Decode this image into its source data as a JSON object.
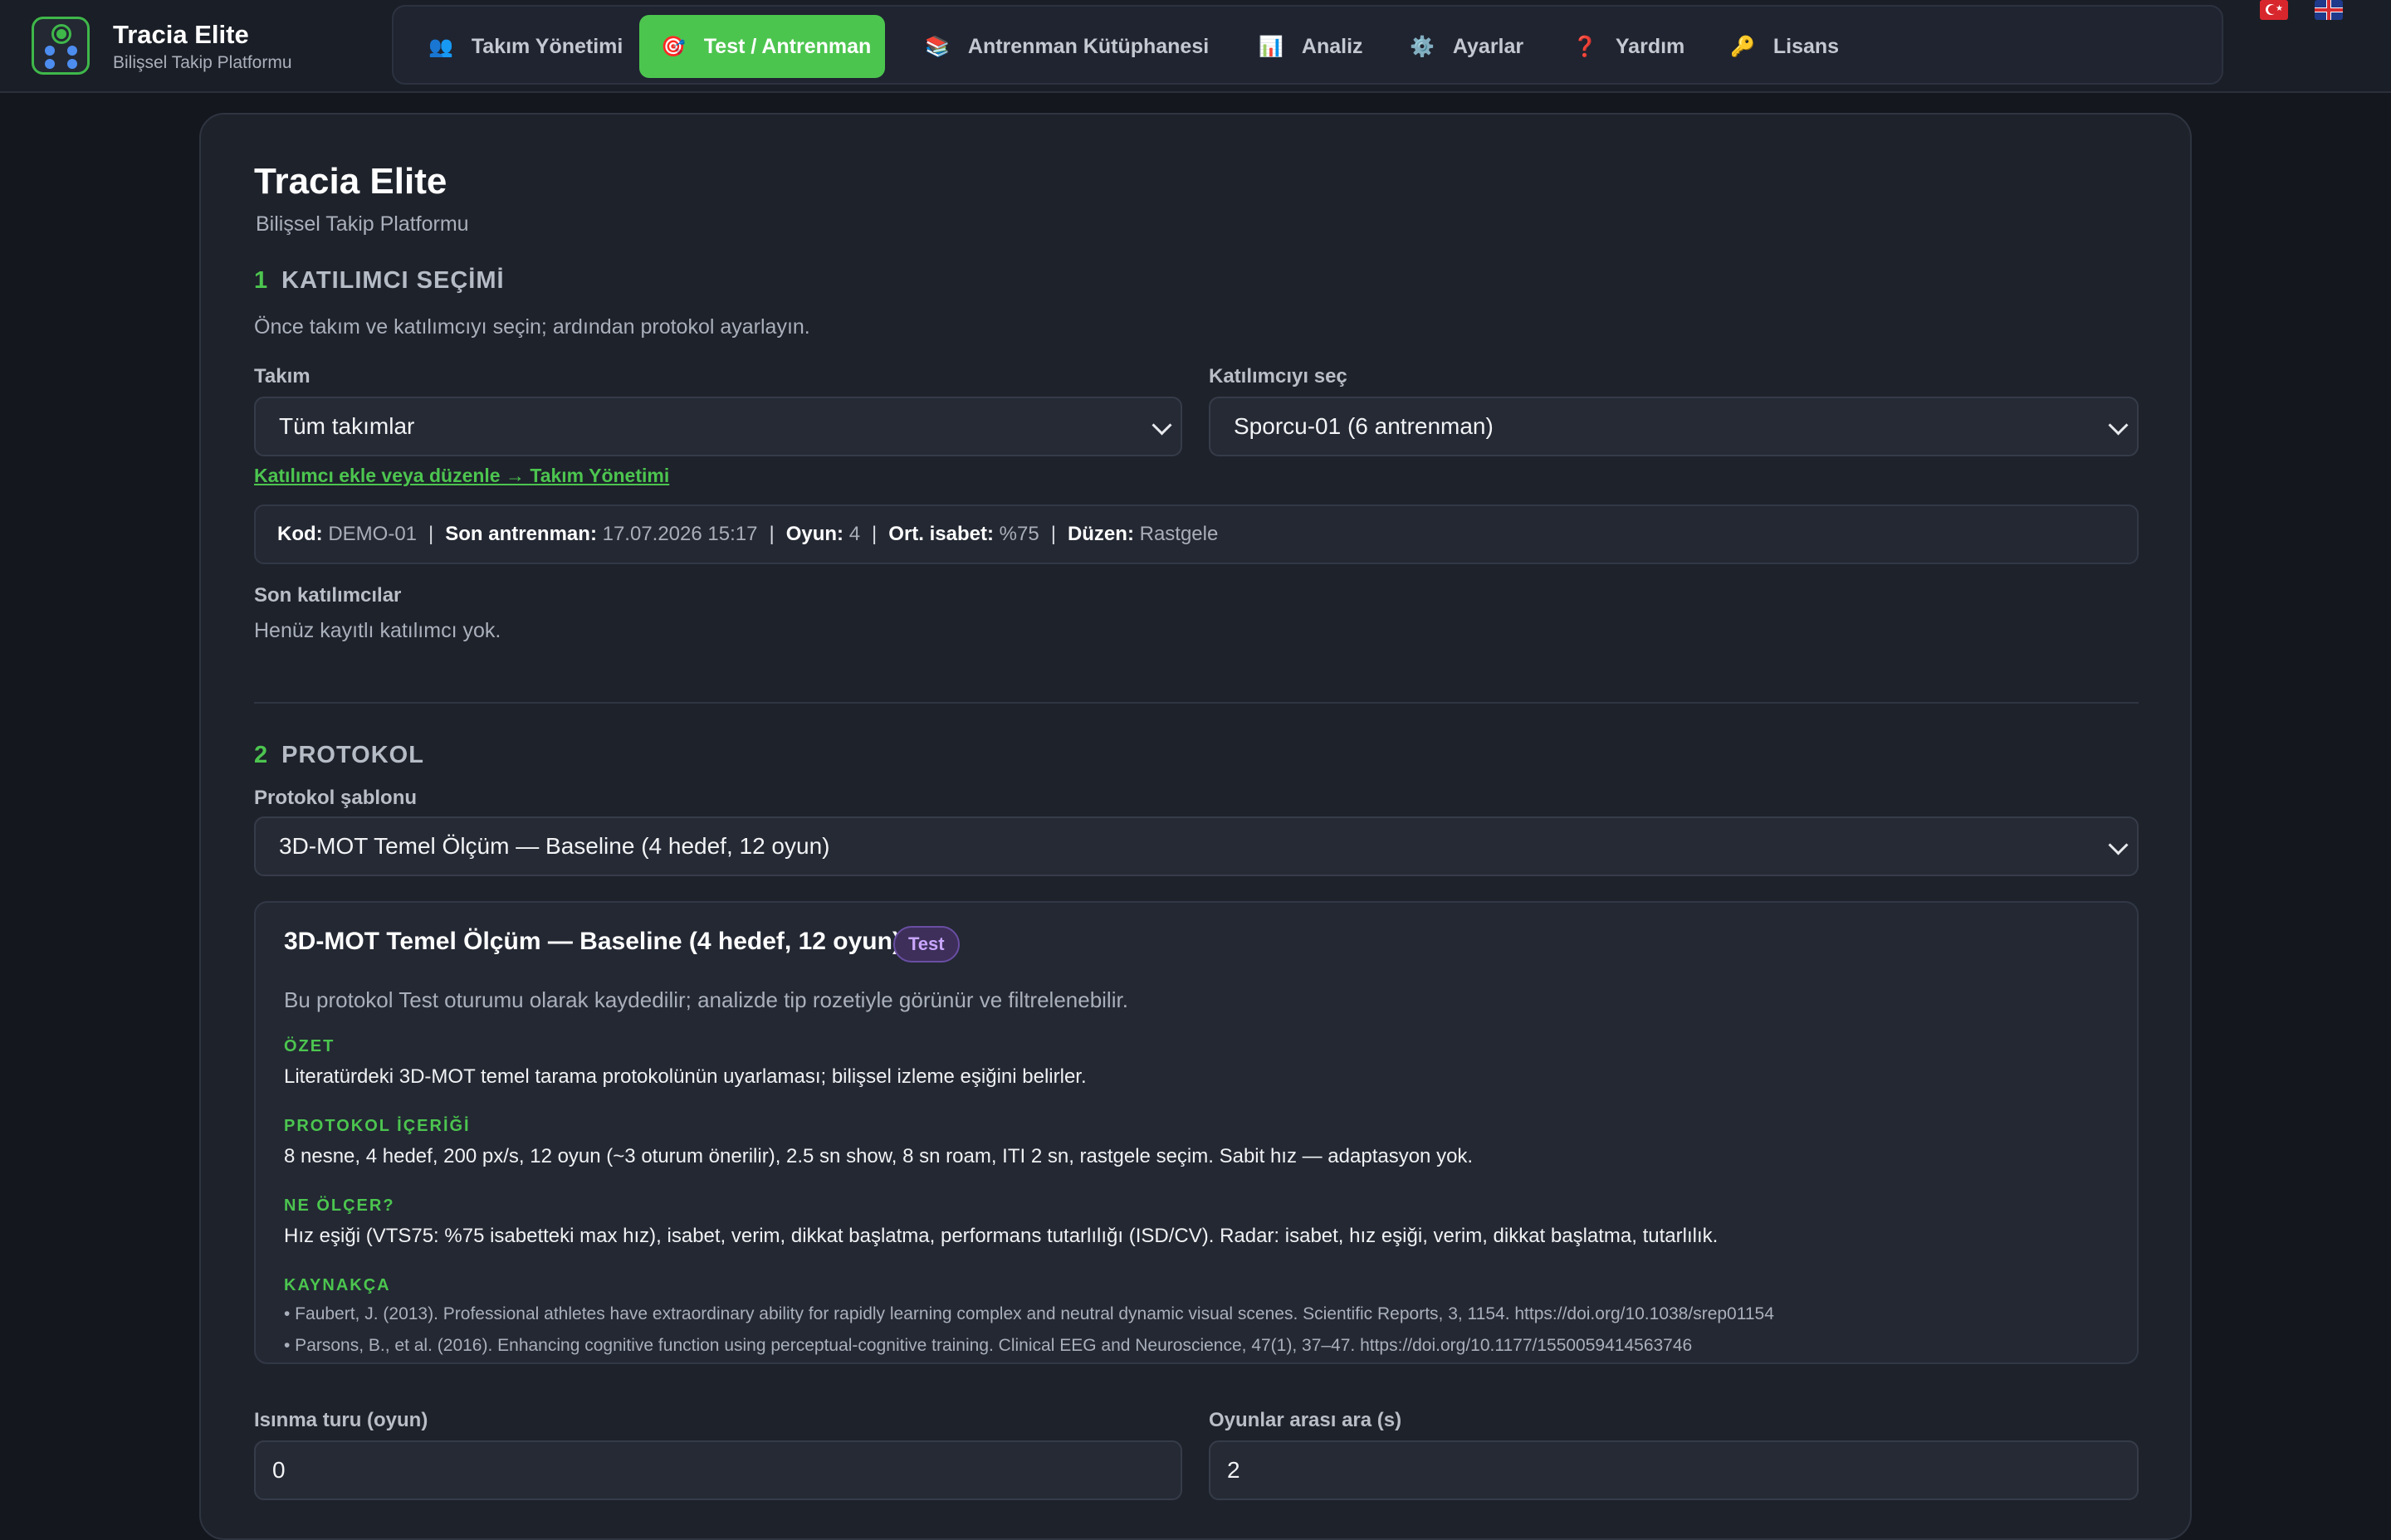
{
  "brand": {
    "title": "Tracia Elite",
    "subtitle": "Bilişsel Takip Platformu"
  },
  "nav": [
    {
      "icon": "👥",
      "icon_name": "team-icon",
      "label": "Takım Yönetimi",
      "active": false
    },
    {
      "icon": "🎯",
      "icon_name": "target-icon",
      "label": "Test / Antrenman",
      "active": true
    },
    {
      "icon": "📚",
      "icon_name": "books-icon",
      "label": "Antrenman Kütüphanesi",
      "active": false
    },
    {
      "icon": "📊",
      "icon_name": "chart-icon",
      "label": "Analiz",
      "active": false
    },
    {
      "icon": "⚙️",
      "icon_name": "gear-icon",
      "label": "Ayarlar",
      "active": false
    },
    {
      "icon": "❓",
      "icon_name": "question-icon",
      "label": "Yardım",
      "active": false
    },
    {
      "icon": "🔑",
      "icon_name": "key-icon",
      "label": "Lisans",
      "active": false
    }
  ],
  "flags": [
    "tr-flag-icon",
    "gb-flag-icon"
  ],
  "colors": {
    "accent": "#4cc54f",
    "background": "#14171d",
    "card": "#1e222b",
    "badge": "#c9a6ff"
  },
  "page": {
    "title": "Tracia Elite",
    "subtitle": "Bilişsel Takip Platformu"
  },
  "section1": {
    "number": "1",
    "title": "KATILIMCI SEÇİMİ",
    "description": "Önce takım ve katılımcıyı seçin; ardından protokol ayarlayın.",
    "team_label": "Takım",
    "team_value": "Tüm takımlar",
    "participant_label": "Katılımcıyı seç",
    "participant_value": "Sporcu-01 (6 antrenman)",
    "manage_link": "Katılımcı ekle veya düzenle → Takım Yönetimi",
    "info": {
      "code_label": "Kod:",
      "code": "DEMO-01",
      "last_label": "Son antrenman:",
      "last": "17.07.2026 15:17",
      "games_label": "Oyun:",
      "games": "4",
      "accuracy_label": "Ort. isabet:",
      "accuracy": "%75",
      "order_label": "Düzen:",
      "order": "Rastgele",
      "separator": "|"
    },
    "recent_label": "Son katılımcılar",
    "recent_empty": "Henüz kayıtlı katılımcı yok."
  },
  "section2": {
    "number": "2",
    "title": "PROTOKOL",
    "template_label": "Protokol şablonu",
    "template_value": "3D-MOT Temel Ölçüm — Baseline (4 hedef, 12 oyun)",
    "card": {
      "title": "3D-MOT Temel Ölçüm — Baseline (4 hedef, 12 oyun)",
      "badge": "Test",
      "note": "Bu protokol Test oturumu olarak kaydedilir; analizde tip rozetiyle görünür ve filtrelenebilir.",
      "summary_label": "ÖZET",
      "summary": "Literatürdeki 3D-MOT temel tarama protokolünün uyarlaması; bilişsel izleme eşiğini belirler.",
      "content_label": "PROTOKOL İÇERİĞİ",
      "content": "8 nesne, 4 hedef, 200 px/s, 12 oyun (~3 oturum önerilir), 2.5 sn show, 8 sn roam, ITI 2 sn, rastgele seçim. Sabit hız — adaptasyon yok.",
      "measures_label": "NE ÖLÇER?",
      "measures": "Hız eşiği (VTS75: %75 isabetteki max hız), isabet, verim, dikkat başlatma, performans tutarlılığı (ISD/CV). Radar: isabet, hız eşiği, verim, dikkat başlatma, tutarlılık.",
      "refs_label": "KAYNAKÇA",
      "refs": [
        "• Faubert, J. (2013). Professional athletes have extraordinary ability for rapidly learning complex and neutral dynamic visual scenes. Scientific Reports, 3, 1154. https://doi.org/10.1038/srep01154",
        "• Parsons, B., et al. (2016). Enhancing cognitive function using perceptual-cognitive training. Clinical EEG and Neuroscience, 47(1), 37–47. https://doi.org/10.1177/1550059414563746"
      ]
    },
    "warmup_label": "Isınma turu (oyun)",
    "warmup_value": "0",
    "pause_label": "Oyunlar arası ara (s)",
    "pause_value": "2"
  }
}
